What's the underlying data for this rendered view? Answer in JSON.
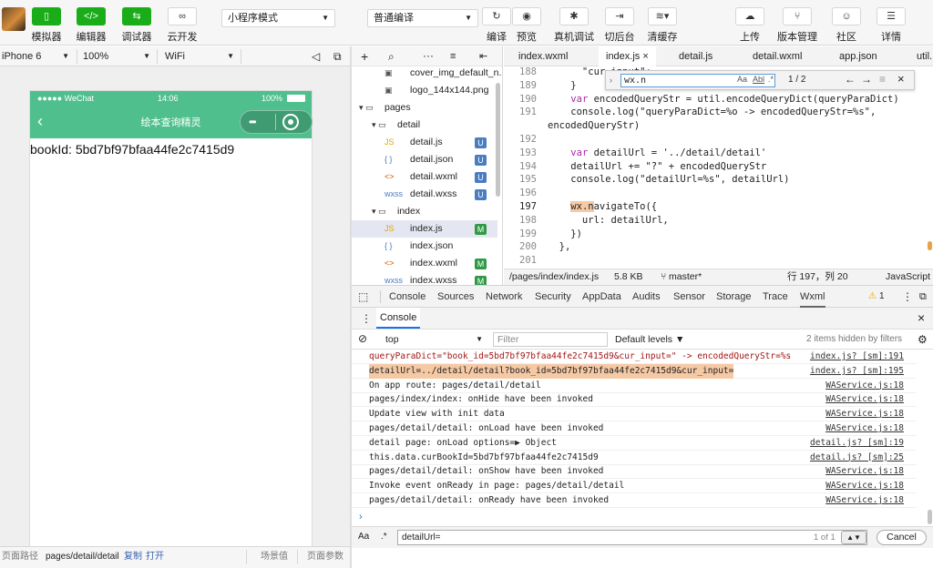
{
  "toolbar": {
    "buttons": [
      {
        "label": "模拟器",
        "icon": "phone-icon",
        "glyph": "▯",
        "active": true
      },
      {
        "label": "编辑器",
        "icon": "code-icon",
        "glyph": "</>",
        "active": true
      },
      {
        "label": "调试器",
        "icon": "debug-icon",
        "glyph": "⇆",
        "active": true
      },
      {
        "label": "云开发",
        "icon": "cloud-link-icon",
        "glyph": "∞",
        "active": false
      }
    ],
    "mode_select": "小程序模式",
    "compile_select": "普通编译",
    "actions": [
      {
        "label": "编译",
        "icon": "refresh-icon",
        "glyph": "↻"
      },
      {
        "label": "预览",
        "icon": "eye-icon",
        "glyph": "◉"
      },
      {
        "label": "真机调试",
        "icon": "bug-icon",
        "glyph": "✱"
      },
      {
        "label": "切后台",
        "icon": "switch-icon",
        "glyph": "⇥"
      },
      {
        "label": "清缓存",
        "icon": "layers-icon",
        "glyph": "≋▾"
      }
    ],
    "right_actions": [
      {
        "label": "上传",
        "icon": "upload-icon",
        "glyph": "☁"
      },
      {
        "label": "版本管理",
        "icon": "branch-icon",
        "glyph": "⑂"
      },
      {
        "label": "社区",
        "icon": "chat-icon",
        "glyph": "☺"
      },
      {
        "label": "详情",
        "icon": "menu-icon",
        "glyph": "☰"
      }
    ]
  },
  "device_bar": {
    "device": "iPhone 6",
    "zoom": "100%",
    "network": "WiFi"
  },
  "phone": {
    "carrier": "●●●●● WeChat",
    "time": "14:06",
    "battery": "100%",
    "title": "绘本查询精灵",
    "content": "bookId: 5bd7bf97bfaa44fe2c7415d9"
  },
  "sim_bottom": {
    "path_label": "页面路径",
    "path": "pages/detail/detail",
    "copy": "复制",
    "open": "打开",
    "scene": "场景值",
    "params": "页面参数"
  },
  "explorer": {
    "rows": [
      {
        "name": "cover_img_default_n...",
        "icon": "image-file-icon",
        "glyph": "▣",
        "indent": 2,
        "badge": ""
      },
      {
        "name": "logo_144x144.png",
        "icon": "image-file-icon",
        "glyph": "▣",
        "indent": 2,
        "badge": ""
      },
      {
        "name": "pages",
        "icon": "folder-icon",
        "glyph": "▾ ▭",
        "indent": 0,
        "badge": ""
      },
      {
        "name": "detail",
        "icon": "folder-icon",
        "glyph": "▾ ▭",
        "indent": 1,
        "badge": ""
      },
      {
        "name": "detail.js",
        "icon": "js-file-icon",
        "glyph": "JS",
        "indent": 2,
        "badge": "U"
      },
      {
        "name": "detail.json",
        "icon": "json-file-icon",
        "glyph": "{ }",
        "indent": 2,
        "badge": "U"
      },
      {
        "name": "detail.wxml",
        "icon": "wxml-file-icon",
        "glyph": "<>",
        "indent": 2,
        "badge": "U"
      },
      {
        "name": "detail.wxss",
        "icon": "wxss-file-icon",
        "glyph": "wxss",
        "indent": 2,
        "badge": "U"
      },
      {
        "name": "index",
        "icon": "folder-icon",
        "glyph": "▾ ▭",
        "indent": 1,
        "badge": ""
      },
      {
        "name": "index.js",
        "icon": "js-file-icon",
        "glyph": "JS",
        "indent": 2,
        "badge": "M",
        "selected": true
      },
      {
        "name": "index.json",
        "icon": "json-file-icon",
        "glyph": "{ }",
        "indent": 2,
        "badge": ""
      },
      {
        "name": "index.wxml",
        "icon": "wxml-file-icon",
        "glyph": "<>",
        "indent": 2,
        "badge": "M"
      },
      {
        "name": "index.wxss",
        "icon": "wxss-file-icon",
        "glyph": "wxss",
        "indent": 2,
        "badge": "M"
      }
    ]
  },
  "editor": {
    "tabs": [
      "index.wxml",
      "index.js",
      "detail.js",
      "detail.wxml",
      "app.json",
      "util..."
    ],
    "active_tab": 1,
    "find": {
      "query": "wx.n",
      "opt_case": "Aa",
      "opt_word": "Abl",
      "opt_regex": ".*",
      "count": "1 / 2"
    },
    "lines": [
      {
        "no": "188",
        "text": "      \"cur_input\":"
      },
      {
        "no": "189",
        "text": "    }"
      },
      {
        "no": "190",
        "text": "    var encodedQueryStr = util.encodeQueryDict(queryParaDict)"
      },
      {
        "no": "191",
        "text": "    console.log(\"queryParaDict=%o -> encodedQueryStr=%s\","
      },
      {
        "no": "",
        "text": "encodedQueryStr)"
      },
      {
        "no": "192",
        "text": ""
      },
      {
        "no": "193",
        "text": "    var detailUrl = '../detail/detail'"
      },
      {
        "no": "194",
        "text": "    detailUrl += \"?\" + encodedQueryStr"
      },
      {
        "no": "195",
        "text": "    console.log(\"detailUrl=%s\", detailUrl)"
      },
      {
        "no": "196",
        "text": ""
      },
      {
        "no": "197",
        "text": "    wx.navigateTo({"
      },
      {
        "no": "198",
        "text": "      url: detailUrl,"
      },
      {
        "no": "199",
        "text": "    })"
      },
      {
        "no": "200",
        "text": "  },"
      },
      {
        "no": "201",
        "text": ""
      }
    ],
    "status": {
      "path": "/pages/index/index.js",
      "size": "5.8 KB",
      "branch": "master*",
      "cursor": "行 197，列 20",
      "lang": "JavaScript"
    }
  },
  "devtools": {
    "tabs": [
      "Console",
      "Sources",
      "Network",
      "Security",
      "AppData",
      "Audits",
      "Sensor",
      "Storage",
      "Trace",
      "Wxml"
    ],
    "active_tab": "Wxml",
    "warnings": "1",
    "console_title": "Console",
    "context": "top",
    "filter_placeholder": "Filter",
    "levels": "Default levels ▼",
    "hidden_note": "2 items hidden by filters",
    "rows": [
      {
        "msg": "queryParaDict=\"book_id=5bd7bf97bfaa44fe2c7415d9&cur_input=\" -> encodedQueryStr=%s",
        "src": "index.js? [sm]:191",
        "highlight": false
      },
      {
        "msg": "detailUrl=../detail/detail?book_id=5bd7bf97bfaa44fe2c7415d9&cur_input=",
        "src": "index.js? [sm]:195",
        "highlight": true
      },
      {
        "msg": "On app route: pages/detail/detail",
        "src": "WAService.js:18",
        "highlight": false
      },
      {
        "msg": "pages/index/index: onHide have been invoked",
        "src": "WAService.js:18",
        "highlight": false
      },
      {
        "msg": "Update view with init data",
        "src": "WAService.js:18",
        "highlight": false
      },
      {
        "msg": "pages/detail/detail: onLoad have been invoked",
        "src": "WAService.js:18",
        "highlight": false
      },
      {
        "msg": "detail page: onLoad options=▶ Object",
        "src": "detail.js? [sm]:19",
        "highlight": false
      },
      {
        "msg": "this.data.curBookId=5bd7bf97bfaa44fe2c7415d9",
        "src": "detail.js? [sm]:25",
        "highlight": false
      },
      {
        "msg": "pages/detail/detail: onShow have been invoked",
        "src": "WAService.js:18",
        "highlight": false
      },
      {
        "msg": "Invoke event onReady in page: pages/detail/detail",
        "src": "WAService.js:18",
        "highlight": false
      },
      {
        "msg": "pages/detail/detail: onReady have been invoked",
        "src": "WAService.js:18",
        "highlight": false
      }
    ],
    "find": {
      "opt_case": "Aa",
      "opt_regex": ".*",
      "query": "detailUrl=",
      "count": "1 of 1",
      "cancel": "Cancel"
    }
  },
  "colors": {
    "accent_green": "#1aad19",
    "nav_green": "#4fc08d",
    "badge_u": "#4a7cc1",
    "badge_m": "#2f9a45",
    "highlight": "#f6c9a5"
  }
}
